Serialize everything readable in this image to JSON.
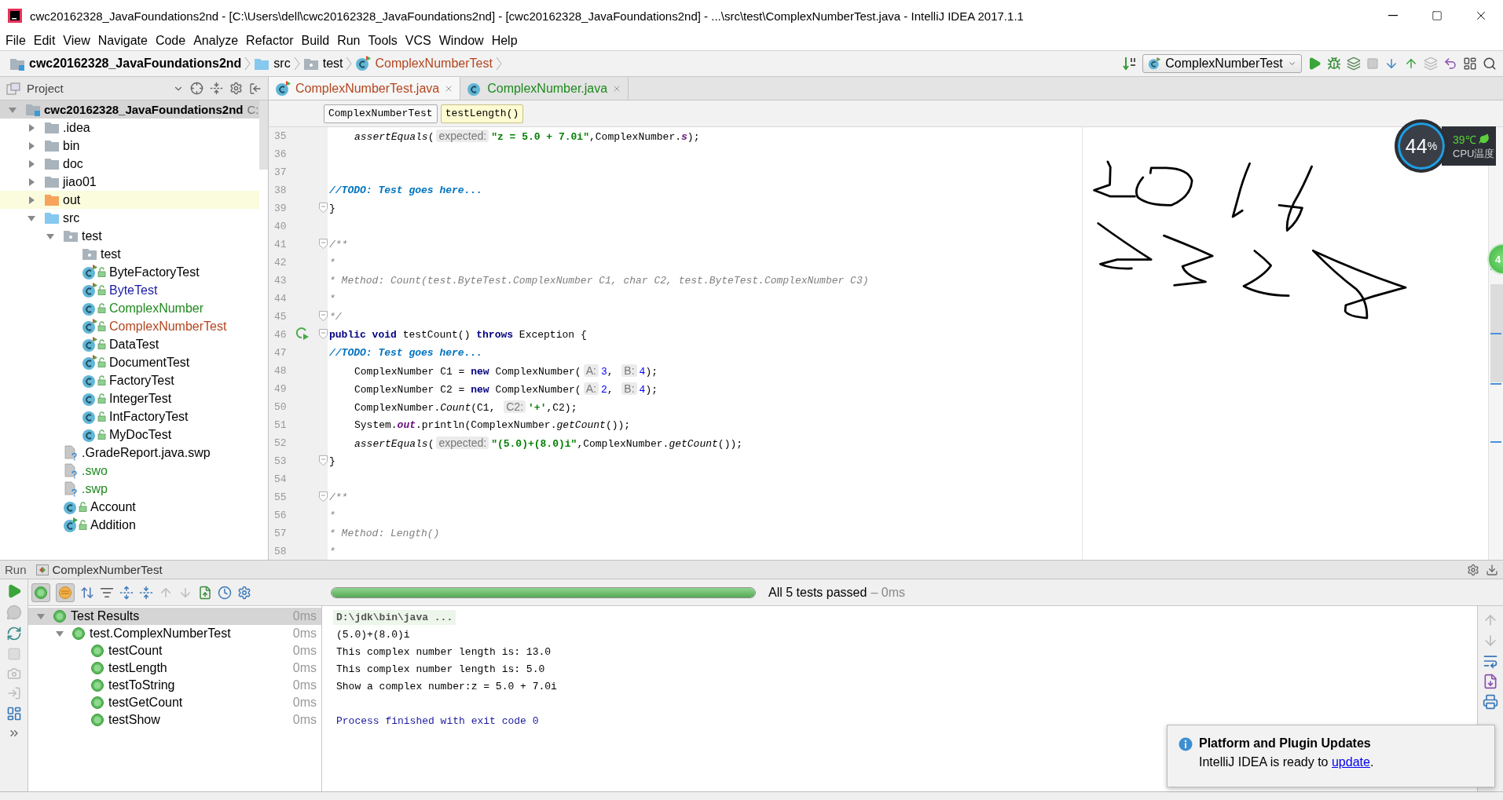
{
  "window": {
    "title": "cwc20162328_JavaFoundations2nd - [C:\\Users\\dell\\cwc20162328_JavaFoundations2nd] - [cwc20162328_JavaFoundations2nd] - ...\\src\\test\\ComplexNumberTest.java - IntelliJ IDEA 2017.1.1"
  },
  "menu": [
    "File",
    "Edit",
    "View",
    "Navigate",
    "Code",
    "Analyze",
    "Refactor",
    "Build",
    "Run",
    "Tools",
    "VCS",
    "Window",
    "Help"
  ],
  "nav_bar": {
    "breadcrumbs": [
      {
        "label": "cwc20162328_JavaFoundations2nd",
        "kind": "module"
      },
      {
        "label": "src",
        "kind": "source_folder"
      },
      {
        "label": "test",
        "kind": "package"
      },
      {
        "label": "ComplexNumberTest",
        "kind": "test_class"
      }
    ],
    "run_config": "ComplexNumberTest"
  },
  "project_panel": {
    "title": "Project",
    "root": {
      "label": "cwc20162328_JavaFoundations2nd",
      "path": "C:",
      "kind": "module",
      "expanded": true,
      "selected": true,
      "children": [
        {
          "label": ".idea",
          "kind": "folder",
          "expanded": false,
          "selected": false,
          "highlighted": false
        },
        {
          "label": "bin",
          "kind": "folder",
          "expanded": false,
          "selected": false,
          "highlighted": false
        },
        {
          "label": "doc",
          "kind": "folder",
          "expanded": false,
          "selected": false,
          "highlighted": false
        },
        {
          "label": "jiao01",
          "kind": "folder",
          "expanded": false,
          "selected": false,
          "highlighted": false
        },
        {
          "label": "out",
          "kind": "excluded_folder",
          "expanded": false,
          "selected": false,
          "highlighted": true
        },
        {
          "label": "src",
          "kind": "source_folder",
          "expanded": true,
          "selected": false,
          "highlighted": false,
          "children": [
            {
              "label": "test",
              "kind": "package",
              "expanded": true,
              "selected": false,
              "children": [
                {
                  "label": "test",
                  "kind": "package",
                  "selected": false
                },
                {
                  "label": "ByteFactoryTest",
                  "kind": "test_class",
                  "selected": false
                },
                {
                  "label": "ByteTest",
                  "kind": "test_class",
                  "selected": false,
                  "color": "#1a1aa6"
                },
                {
                  "label": "ComplexNumber",
                  "kind": "class",
                  "selected": false,
                  "color": "#1e8a1e"
                },
                {
                  "label": "ComplexNumberTest",
                  "kind": "test_class",
                  "selected": false,
                  "color": "#b3461f"
                },
                {
                  "label": "DataTest",
                  "kind": "test_class",
                  "selected": false
                },
                {
                  "label": "DocumentTest",
                  "kind": "test_class",
                  "selected": false
                },
                {
                  "label": "FactoryTest",
                  "kind": "class",
                  "selected": false
                },
                {
                  "label": "IntegerTest",
                  "kind": "class",
                  "selected": false
                },
                {
                  "label": "IntFactoryTest",
                  "kind": "class",
                  "selected": false
                },
                {
                  "label": "MyDocTest",
                  "kind": "class",
                  "selected": false
                }
              ]
            },
            {
              "label": ".GradeReport.java.swp",
              "kind": "unknown_file",
              "selected": false
            },
            {
              "label": ".swo",
              "kind": "unknown_file",
              "selected": false,
              "color": "#1e8a1e"
            },
            {
              "label": ".swp",
              "kind": "unknown_file",
              "selected": false,
              "color": "#1e8a1e"
            },
            {
              "label": "Account",
              "kind": "class",
              "selected": false
            },
            {
              "label": "Addition",
              "kind": "main_class",
              "selected": false
            }
          ]
        }
      ]
    }
  },
  "editor": {
    "tabs": [
      {
        "label": "ComplexNumberTest.java",
        "kind": "test_class",
        "selected": true,
        "color": "#b3461f"
      },
      {
        "label": "ComplexNumber.java",
        "kind": "class",
        "selected": false,
        "color": "#1e8a1e"
      }
    ],
    "breadcrumbs": [
      {
        "label": "ComplexNumberTest",
        "selected": false
      },
      {
        "label": "testLength()",
        "selected": true
      }
    ],
    "lines": [
      {
        "number": "35",
        "fold": false,
        "run_marker": false,
        "indented": true,
        "tokens": [
          {
            "kind": "call",
            "text": "assertEquals"
          },
          {
            "kind": "plain",
            "text": "("
          },
          {
            "kind": "hint",
            "text": "expected:"
          },
          {
            "kind": "string",
            "text": "\"z = 5.0 + 7.0i\""
          },
          {
            "kind": "plain",
            "text": ",ComplexNumber."
          },
          {
            "kind": "field",
            "text": "s"
          },
          {
            "kind": "plain",
            "text": ");"
          }
        ]
      },
      {
        "number": "36",
        "fold": false,
        "run_marker": false
      },
      {
        "number": "37",
        "fold": false,
        "run_marker": false
      },
      {
        "number": "38",
        "fold": false,
        "run_marker": false,
        "indented": false,
        "tokens": [
          {
            "kind": "todo",
            "text": "//TODO: Test goes here..."
          }
        ]
      },
      {
        "number": "39",
        "fold": true,
        "run_marker": false,
        "indented": false,
        "tokens": [
          {
            "kind": "plain",
            "text": "}"
          }
        ]
      },
      {
        "number": "40",
        "fold": false,
        "run_marker": false
      },
      {
        "number": "41",
        "fold": true,
        "run_marker": false,
        "indented": false,
        "tokens": [
          {
            "kind": "comment",
            "text": "/**"
          }
        ]
      },
      {
        "number": "42",
        "fold": false,
        "run_marker": false,
        "indented": false,
        "tokens": [
          {
            "kind": "comment",
            "text": "*"
          }
        ]
      },
      {
        "number": "43",
        "fold": false,
        "run_marker": false,
        "indented": false,
        "tokens": [
          {
            "kind": "comment",
            "text": "* Method: Count(test.ByteTest.ComplexNumber C1, char C2, test.ByteTest.ComplexNumber C3)"
          }
        ]
      },
      {
        "number": "44",
        "fold": false,
        "run_marker": false,
        "indented": false,
        "tokens": [
          {
            "kind": "comment",
            "text": "*"
          }
        ]
      },
      {
        "number": "45",
        "fold": true,
        "run_marker": false,
        "indented": false,
        "tokens": [
          {
            "kind": "comment",
            "text": "*/"
          }
        ]
      },
      {
        "number": "46",
        "fold": true,
        "run_marker": true,
        "indented": false,
        "tokens": [
          {
            "kind": "keyword",
            "text": "public void"
          },
          {
            "kind": "plain",
            "text": " testCount() "
          },
          {
            "kind": "keyword",
            "text": "throws"
          },
          {
            "kind": "plain",
            "text": " Exception {"
          }
        ]
      },
      {
        "number": "47",
        "fold": false,
        "run_marker": false,
        "indented": false,
        "tokens": [
          {
            "kind": "todo",
            "text": "//TODO: Test goes here..."
          }
        ]
      },
      {
        "number": "48",
        "fold": false,
        "run_marker": false,
        "indented": true,
        "tokens": [
          {
            "kind": "plain",
            "text": "ComplexNumber C1 = "
          },
          {
            "kind": "keyword",
            "text": "new"
          },
          {
            "kind": "plain",
            "text": " ComplexNumber("
          },
          {
            "kind": "hint",
            "text": "A:"
          },
          {
            "kind": "number",
            "text": "3"
          },
          {
            "kind": "plain",
            "text": ", "
          },
          {
            "kind": "hint",
            "text": "B:"
          },
          {
            "kind": "number",
            "text": "4"
          },
          {
            "kind": "plain",
            "text": ");"
          }
        ]
      },
      {
        "number": "49",
        "fold": false,
        "run_marker": false,
        "indented": true,
        "tokens": [
          {
            "kind": "plain",
            "text": "ComplexNumber C2 = "
          },
          {
            "kind": "keyword",
            "text": "new"
          },
          {
            "kind": "plain",
            "text": " ComplexNumber("
          },
          {
            "kind": "hint",
            "text": "A:"
          },
          {
            "kind": "number",
            "text": "2"
          },
          {
            "kind": "plain",
            "text": ", "
          },
          {
            "kind": "hint",
            "text": "B:"
          },
          {
            "kind": "number",
            "text": "4"
          },
          {
            "kind": "plain",
            "text": ");"
          }
        ]
      },
      {
        "number": "50",
        "fold": false,
        "run_marker": false,
        "indented": true,
        "tokens": [
          {
            "kind": "plain",
            "text": "ComplexNumber."
          },
          {
            "kind": "call",
            "text": "Count"
          },
          {
            "kind": "plain",
            "text": "(C1, "
          },
          {
            "kind": "hint",
            "text": "C2:"
          },
          {
            "kind": "string",
            "text": "'+'"
          },
          {
            "kind": "plain",
            "text": ",C2);"
          }
        ]
      },
      {
        "number": "51",
        "fold": false,
        "run_marker": false,
        "indented": true,
        "tokens": [
          {
            "kind": "plain",
            "text": "System."
          },
          {
            "kind": "field",
            "text": "out"
          },
          {
            "kind": "plain",
            "text": ".println(ComplexNumber."
          },
          {
            "kind": "call",
            "text": "getCount"
          },
          {
            "kind": "plain",
            "text": "());"
          }
        ]
      },
      {
        "number": "52",
        "fold": false,
        "run_marker": false,
        "indented": true,
        "tokens": [
          {
            "kind": "call",
            "text": "assertEquals"
          },
          {
            "kind": "plain",
            "text": "("
          },
          {
            "kind": "hint",
            "text": "expected:"
          },
          {
            "kind": "string",
            "text": "\"(5.0)+(8.0)i\""
          },
          {
            "kind": "plain",
            "text": ",ComplexNumber."
          },
          {
            "kind": "call",
            "text": "getCount"
          },
          {
            "kind": "plain",
            "text": "());"
          }
        ]
      },
      {
        "number": "53",
        "fold": true,
        "run_marker": false,
        "indented": false,
        "tokens": [
          {
            "kind": "plain",
            "text": "}"
          }
        ]
      },
      {
        "number": "54",
        "fold": false,
        "run_marker": false
      },
      {
        "number": "55",
        "fold": true,
        "run_marker": false,
        "indented": false,
        "tokens": [
          {
            "kind": "comment",
            "text": "/**"
          }
        ]
      },
      {
        "number": "56",
        "fold": false,
        "run_marker": false,
        "indented": false,
        "tokens": [
          {
            "kind": "comment",
            "text": "*"
          }
        ]
      },
      {
        "number": "57",
        "fold": false,
        "run_marker": false,
        "indented": false,
        "tokens": [
          {
            "kind": "comment",
            "text": "* Method: Length()"
          }
        ]
      },
      {
        "number": "58",
        "fold": false,
        "run_marker": false,
        "indented": false,
        "tokens": [
          {
            "kind": "comment",
            "text": "*"
          }
        ]
      }
    ]
  },
  "run_panel": {
    "title": "Run",
    "tab": "ComplexNumberTest",
    "show_passed": true,
    "show_ignored": true,
    "progress": {
      "level": 1
    },
    "status": "All 5 tests passed",
    "duration": "– 0ms",
    "tests": [
      {
        "label": "Test Results",
        "time": "0ms",
        "passed": true,
        "expanded": true,
        "selected": true,
        "children": [
          {
            "label": "test.ComplexNumberTest",
            "time": "0ms",
            "passed": true,
            "expanded": true,
            "selected": false,
            "children": [
              {
                "label": "testCount",
                "time": "0ms",
                "passed": true,
                "selected": false
              },
              {
                "label": "testLength",
                "time": "0ms",
                "passed": true,
                "selected": false
              },
              {
                "label": "testToString",
                "time": "0ms",
                "passed": true,
                "selected": false
              },
              {
                "label": "testGetCount",
                "time": "0ms",
                "passed": true,
                "selected": false
              },
              {
                "label": "testShow",
                "time": "0ms",
                "passed": true,
                "selected": false
              }
            ]
          }
        ]
      }
    ],
    "console": [
      {
        "kind": "command",
        "text": "D:\\jdk\\bin\\java ..."
      },
      {
        "kind": "output",
        "text": "(5.0)+(8.0)i"
      },
      {
        "kind": "output",
        "text": "This complex number length is: 13.0"
      },
      {
        "kind": "output",
        "text": "This complex number length is: 5.0"
      },
      {
        "kind": "output",
        "text": "Show a complex number:z = 5.0 + 7.0i"
      },
      {
        "kind": "exit",
        "text": "Process finished with exit code 0"
      }
    ]
  },
  "notification": {
    "title": "Platform and Plugin Updates",
    "text": "IntelliJ IDEA is ready to",
    "link": "update",
    "end": "."
  },
  "cpu_monitor": {
    "usage": "44",
    "unit": "%",
    "temperature": "39℃",
    "label": "CPU温度",
    "badge": "4"
  }
}
